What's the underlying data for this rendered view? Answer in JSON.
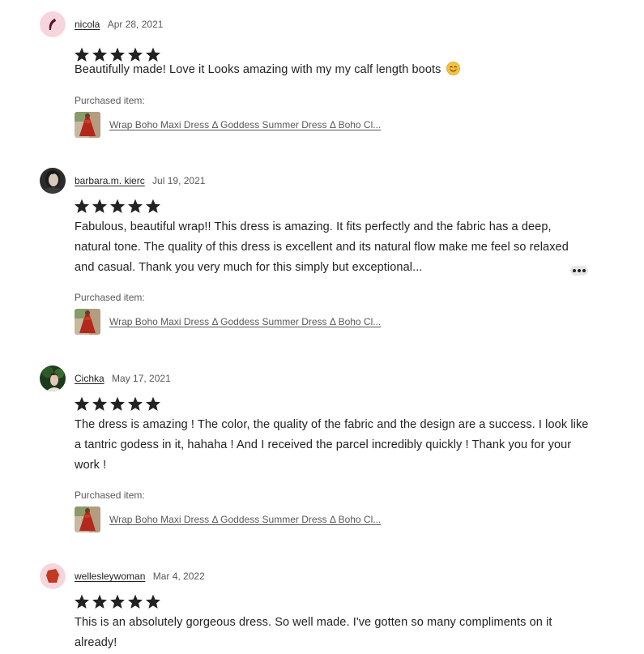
{
  "purchased_label": "Purchased item:",
  "reviews": [
    {
      "author": "nicola",
      "date": "Apr 28, 2021",
      "rating": 5,
      "text": "Beautifully made! Love it Looks amazing with my my calf length boots",
      "emoji": "smiling-face-emoji",
      "item_title": "Wrap Boho Maxi Dress Δ Goddess Summer Dress Δ Boho Cl..."
    },
    {
      "author": "barbara.m. kierc",
      "date": "Jul 19, 2021",
      "rating": 5,
      "text": "Fabulous, beautiful wrap!! This dress is amazing. It fits perfectly and the fabric has a deep, natural tone. The quality of this dress is excellent and its natural flow make me feel so relaxed and casual. Thank you very much for this simply but exceptional...",
      "item_title": "Wrap Boho Maxi Dress Δ Goddess Summer Dress Δ Boho Cl..."
    },
    {
      "author": "Cichka",
      "date": "May 17, 2021",
      "rating": 5,
      "text": "The dress is amazing ! The color, the quality of the fabric and the design are a success. I look like a tantric godess in it, hahaha ! And I received the parcel incredibly quickly ! Thank you for your work !",
      "item_title": "Wrap Boho Maxi Dress Δ Goddess Summer Dress Δ Boho Cl..."
    },
    {
      "author": "wellesleywoman",
      "date": "Mar 4, 2022",
      "rating": 5,
      "text": "This is an absolutely gorgeous dress. So well made. I've gotten so many compliments on it already!"
    }
  ],
  "colors": {
    "text": "#222222",
    "secondary_text": "#595959",
    "star": "#222222",
    "avatar_pink": "#f6d5dc",
    "avatar_shape_red": "#c23a22"
  }
}
